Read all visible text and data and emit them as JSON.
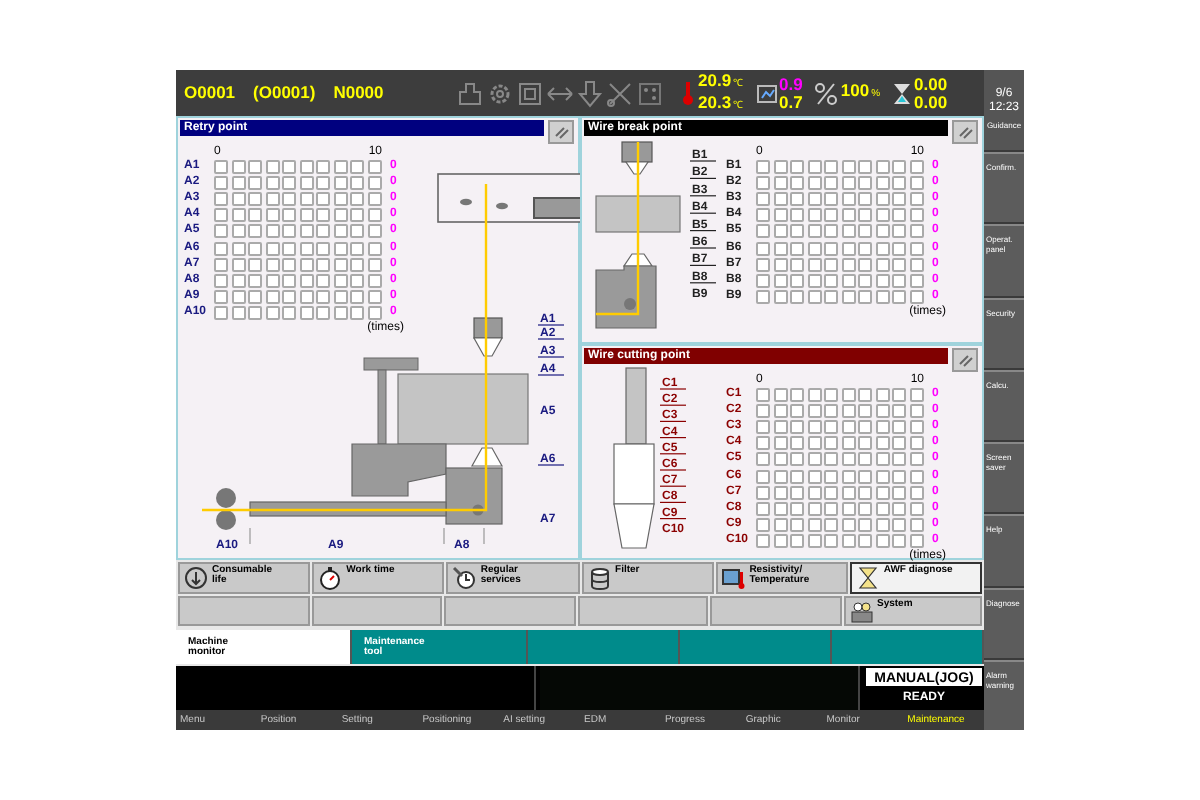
{
  "header": {
    "program": "O0001",
    "program_parenthesized": "(O0001)",
    "sequence": "N0000",
    "readings": [
      {
        "kind": "temperature",
        "lines": [
          {
            "value": "20.9",
            "unit": "℃",
            "color": "#ffff00"
          },
          {
            "value": "20.3",
            "unit": "℃",
            "color": "#ffff00"
          }
        ]
      },
      {
        "kind": "conductivity",
        "lines": [
          {
            "value": "0.9",
            "color": "#ff00ff"
          },
          {
            "value": "0.7",
            "color": "#ffff00"
          }
        ]
      },
      {
        "kind": "percent",
        "lines": [
          {
            "value": "100",
            "unit": "%",
            "color": "#ffff00"
          }
        ]
      },
      {
        "kind": "timer",
        "lines": [
          {
            "value": "0.00",
            "color": "#ffff00"
          },
          {
            "value": "0.00",
            "color": "#ffff00"
          }
        ]
      }
    ],
    "date": "9/6",
    "time": "12:23",
    "guidance": "Guidance"
  },
  "side_menu": [
    "Confirm.",
    "Operat.\npanel",
    "Security",
    "Calcu.",
    "Screen\nsaver",
    "Help",
    "Diagnose",
    "Alarm\nwarning"
  ],
  "retry_point": {
    "title": "Retry point",
    "scale_start": "0",
    "scale_end": "10",
    "unit": "(times)",
    "rows": [
      {
        "label": "A1",
        "count": "0"
      },
      {
        "label": "A2",
        "count": "0"
      },
      {
        "label": "A3",
        "count": "0"
      },
      {
        "label": "A4",
        "count": "0"
      },
      {
        "label": "A5",
        "count": "0"
      },
      {
        "label": "A6",
        "count": "0"
      },
      {
        "label": "A7",
        "count": "0"
      },
      {
        "label": "A8",
        "count": "0"
      },
      {
        "label": "A9",
        "count": "0"
      },
      {
        "label": "A10",
        "count": "0"
      }
    ],
    "diagram_labels": [
      "A1",
      "A2",
      "A3",
      "A4",
      "A5",
      "A6",
      "A7",
      "A10",
      "A9",
      "A8"
    ]
  },
  "wire_break_point": {
    "title": "Wire break point",
    "scale_start": "0",
    "scale_end": "10",
    "unit": "(times)",
    "rows": [
      {
        "label": "B1",
        "count": "0"
      },
      {
        "label": "B2",
        "count": "0"
      },
      {
        "label": "B3",
        "count": "0"
      },
      {
        "label": "B4",
        "count": "0"
      },
      {
        "label": "B5",
        "count": "0"
      },
      {
        "label": "B6",
        "count": "0"
      },
      {
        "label": "B7",
        "count": "0"
      },
      {
        "label": "B8",
        "count": "0"
      },
      {
        "label": "B9",
        "count": "0"
      }
    ],
    "diagram_labels": [
      "B1",
      "B2",
      "B3",
      "B4",
      "B5",
      "B6",
      "B7",
      "B8",
      "B9"
    ]
  },
  "wire_cutting_point": {
    "title": "Wire cutting point",
    "scale_start": "0",
    "scale_end": "10",
    "unit": "(times)",
    "rows": [
      {
        "label": "C1",
        "count": "0"
      },
      {
        "label": "C2",
        "count": "0"
      },
      {
        "label": "C3",
        "count": "0"
      },
      {
        "label": "C4",
        "count": "0"
      },
      {
        "label": "C5",
        "count": "0"
      },
      {
        "label": "C6",
        "count": "0"
      },
      {
        "label": "C7",
        "count": "0"
      },
      {
        "label": "C8",
        "count": "0"
      },
      {
        "label": "C9",
        "count": "0"
      },
      {
        "label": "C10",
        "count": "0"
      }
    ],
    "diagram_labels": [
      "C1",
      "C2",
      "C3",
      "C4",
      "C5",
      "C6",
      "C7",
      "C8",
      "C9",
      "C10"
    ]
  },
  "function_buttons": [
    {
      "label": "Consumable\nlife",
      "selected": false
    },
    {
      "label": "Work time",
      "selected": false
    },
    {
      "label": "Regular\nservices",
      "selected": false
    },
    {
      "label": "Filter",
      "selected": false
    },
    {
      "label": "Resistivity/\nTemperature",
      "selected": false
    },
    {
      "label": "AWF diagnose",
      "selected": true
    }
  ],
  "system_button": {
    "label": "System"
  },
  "tabs": [
    {
      "label": "Machine\nmonitor",
      "selected": true
    },
    {
      "label": "Maintenance\ntool",
      "selected": false
    }
  ],
  "mode": "MANUAL(JOG)",
  "state": "READY",
  "bottom_menu": [
    {
      "label": "Menu",
      "selected": false
    },
    {
      "label": "Position",
      "selected": false
    },
    {
      "label": "Setting",
      "selected": false
    },
    {
      "label": "Positioning",
      "selected": false
    },
    {
      "label": "AI setting",
      "selected": false
    },
    {
      "label": "EDM",
      "selected": false
    },
    {
      "label": "Progress",
      "selected": false
    },
    {
      "label": "Graphic",
      "selected": false
    },
    {
      "label": "Monitor",
      "selected": false
    },
    {
      "label": "Maintenance",
      "selected": true
    }
  ]
}
